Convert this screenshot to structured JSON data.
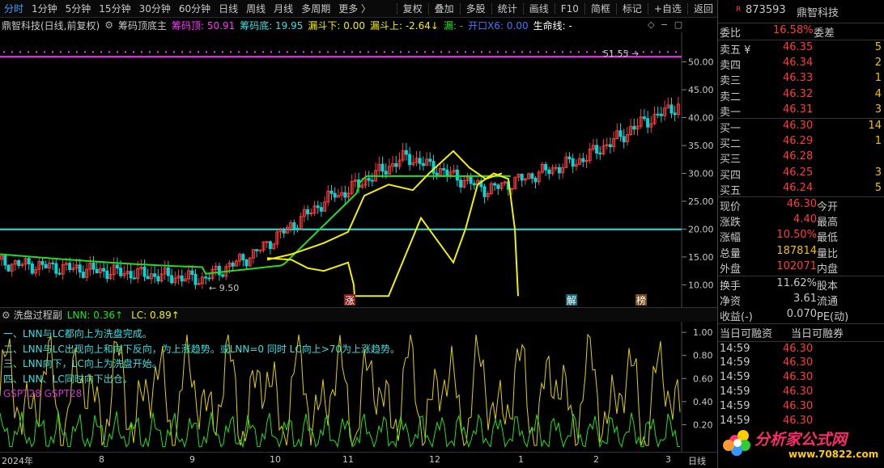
{
  "toolbar": {
    "items": [
      "分时",
      "1分钟",
      "5分钟",
      "15分钟",
      "30分钟",
      "60分钟",
      "日线",
      "周线",
      "月线",
      "多周期",
      "更多 〉"
    ],
    "right_items": [
      "复权",
      "叠加",
      "多股",
      "统计",
      "画线",
      "F10",
      "简框",
      "标记",
      "+自选",
      "返回"
    ]
  },
  "infobar": {
    "stock": "鼎智科技(日线,前复权)",
    "indicator": "筹码顶底主",
    "top_label": "筹码顶: 50.91",
    "bottom_label": "筹码底: 19.95",
    "leak_down": "漏斗下: 0.00",
    "leak_up": "漏斗上: -2.64↓",
    "leak": "漏: -",
    "open_label": "开口X6: 0.00",
    "life_line": "生命线: -"
  },
  "main_chart": {
    "y_ticks": [
      "50.00",
      "45.00",
      "40.00",
      "35.00",
      "30.00",
      "25.00",
      "20.00",
      "15.00",
      "10.00"
    ],
    "high_label": "51.55 →",
    "low_label": "← 9.50",
    "markers": {
      "zhang": "涨",
      "jie": "解",
      "bang": "榜"
    },
    "colors": {
      "up": "#ff3b3b",
      "down": "#00d7d7",
      "top_line": "#ff33ff",
      "bottom_line": "#33e0e0",
      "band": "#22dd22",
      "yellow": "#f0f000"
    }
  },
  "sub_indicator": {
    "name": "洗盘过程副",
    "lnn": "LNN: 0.36↑",
    "lc": "LC: 0.89↑",
    "notes": [
      "一、LNN与LC都向上为洗盘完成。",
      "二、LNN与LC出现向上和向下反向，为上涨趋势。或LNN=0 同时 LC向上>70为上涨趋势。",
      "三、LNN向下，LC向上为洗盘开始。",
      "四、LNN、LC同时向下出仓。"
    ],
    "gspt": "GSPT28   GSPT28",
    "y_ticks": [
      "1.00",
      "0.80",
      "0.60",
      "0.40",
      "0.20"
    ]
  },
  "time_axis": {
    "labels": [
      "2024年",
      "8",
      "9",
      "10",
      "11",
      "12",
      "1",
      "2",
      "3"
    ],
    "period": "日线"
  },
  "sidebar": {
    "code": "873593",
    "name": "鼎智科技",
    "wei_bi_label": "委比",
    "wei_bi": "16.58%",
    "wei_cha_label": "委差",
    "sell": [
      {
        "label": "卖五 ¥",
        "price": "46.35",
        "vol": "5"
      },
      {
        "label": "卖四",
        "price": "46.34",
        "vol": "2"
      },
      {
        "label": "卖三",
        "price": "46.33",
        "vol": "1"
      },
      {
        "label": "卖二",
        "price": "46.32",
        "vol": "4"
      },
      {
        "label": "卖一",
        "price": "46.31",
        "vol": "3"
      }
    ],
    "buy": [
      {
        "label": "买一",
        "price": "46.30",
        "vol": "14"
      },
      {
        "label": "买二",
        "price": "46.29",
        "vol": "1"
      },
      {
        "label": "买三",
        "price": "46.28",
        "vol": ""
      },
      {
        "label": "买四",
        "price": "46.25",
        "vol": "3"
      },
      {
        "label": "买五",
        "price": "46.24",
        "vol": "5"
      }
    ],
    "quote": [
      {
        "l": "现价",
        "v": "46.30",
        "r": "今开"
      },
      {
        "l": "涨跌",
        "v": "4.40",
        "r": "最高"
      },
      {
        "l": "涨幅",
        "v": "10.50%",
        "r": "最低"
      },
      {
        "l": "总量",
        "v": "187814",
        "r": "量比"
      },
      {
        "l": "外盘",
        "v": "102071",
        "r": "内盘"
      }
    ],
    "quote2": [
      {
        "l": "换手",
        "v": "11.62%",
        "r": "股本"
      },
      {
        "l": "净资",
        "v": "3.61",
        "r": "流通"
      },
      {
        "l": "收益(-)",
        "v": "0.070",
        "r": "PE(动)"
      }
    ],
    "fin_header": [
      "当日可融资",
      "当日可融券"
    ],
    "ticks": [
      {
        "t": "14:59",
        "p": "46.30"
      },
      {
        "t": "14:59",
        "p": "46.30"
      },
      {
        "t": "14:59",
        "p": "46.30"
      },
      {
        "t": "14:59",
        "p": "46.30"
      },
      {
        "t": "14:59",
        "p": "46.30"
      },
      {
        "t": "14:59",
        "p": "46.30"
      }
    ]
  },
  "logo": {
    "text": "分析家公式网",
    "url": "www.70822.com"
  }
}
